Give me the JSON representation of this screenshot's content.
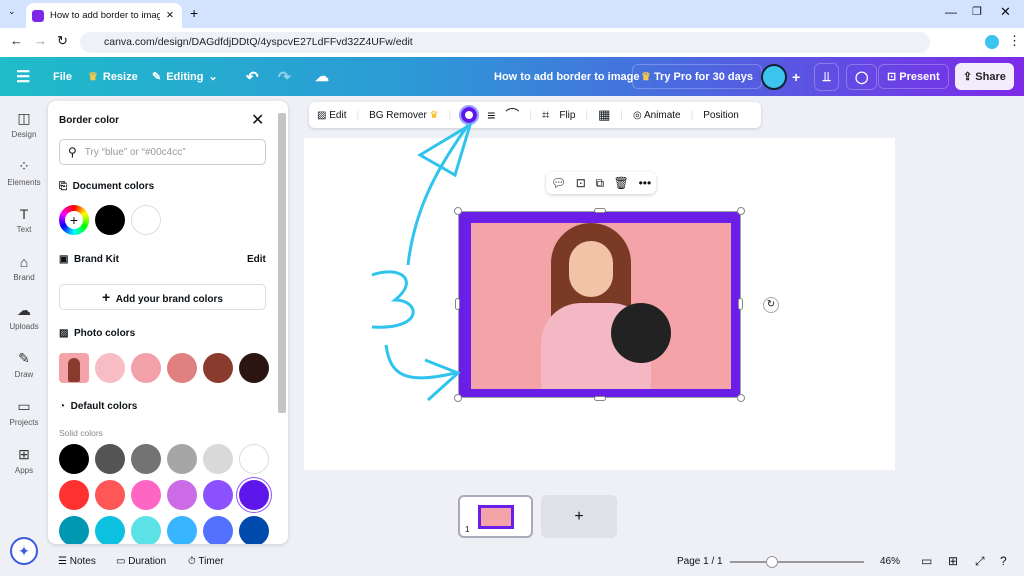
{
  "browser": {
    "tab_title": "How to add border to image - Canva",
    "url": "canva.com/design/DAGdfdjDDtQ/4yspcvE27LdFFvd32Z4UFw/edit"
  },
  "topbar": {
    "file": "File",
    "resize": "Resize",
    "editing": "Editing",
    "doc_title": "How to add border to image",
    "try_pro": "Try Pro for 30 days",
    "present": "Present",
    "share": "Share"
  },
  "rail": [
    {
      "label": "Design",
      "icon": "layout-icon"
    },
    {
      "label": "Elements",
      "icon": "shapes-icon"
    },
    {
      "label": "Text",
      "icon": "text-icon"
    },
    {
      "label": "Brand",
      "icon": "brand-icon"
    },
    {
      "label": "Uploads",
      "icon": "cloud-upload-icon"
    },
    {
      "label": "Draw",
      "icon": "pen-icon"
    },
    {
      "label": "Projects",
      "icon": "folder-icon"
    },
    {
      "label": "Apps",
      "icon": "apps-icon"
    }
  ],
  "panel": {
    "title": "Border color",
    "search_placeholder": "Try “blue” or “#00c4cc”",
    "document_colors": "Document colors",
    "doc_swatches": [
      "#000000",
      "#ffffff"
    ],
    "brand_kit": "Brand Kit",
    "edit": "Edit",
    "add_brand": "Add your brand colors",
    "photo_colors": "Photo colors",
    "photo_swatches": [
      "#f7bcc4",
      "#f2a1a8",
      "#e08080",
      "#8b3a2e",
      "#2a1512"
    ],
    "default_colors": "Default colors",
    "solid_colors": "Solid colors",
    "solid_swatches": [
      [
        "#000000",
        "#545454",
        "#737373",
        "#a6a6a6",
        "#d9d9d9",
        "#ffffff"
      ],
      [
        "#ff3131",
        "#ff5757",
        "#ff66c4",
        "#cb6ce6",
        "#8c52ff",
        "#5e17eb"
      ],
      [
        "#0097b2",
        "#0cc0df",
        "#5ce1e6",
        "#38b6ff",
        "#5271ff",
        "#004aad"
      ]
    ],
    "selected_color": "#5e17eb"
  },
  "toolbar": {
    "edit": "Edit",
    "bg_remover": "BG Remover",
    "flip": "Flip",
    "animate": "Animate",
    "position": "Position"
  },
  "annotation": {
    "number": "3"
  },
  "pages": {
    "thumb_number": "1",
    "add_page": "+"
  },
  "bottom": {
    "notes": "Notes",
    "duration": "Duration",
    "timer": "Timer",
    "page_count": "Page 1 / 1",
    "zoom": "46%",
    "zoom_fraction": 0.46
  }
}
